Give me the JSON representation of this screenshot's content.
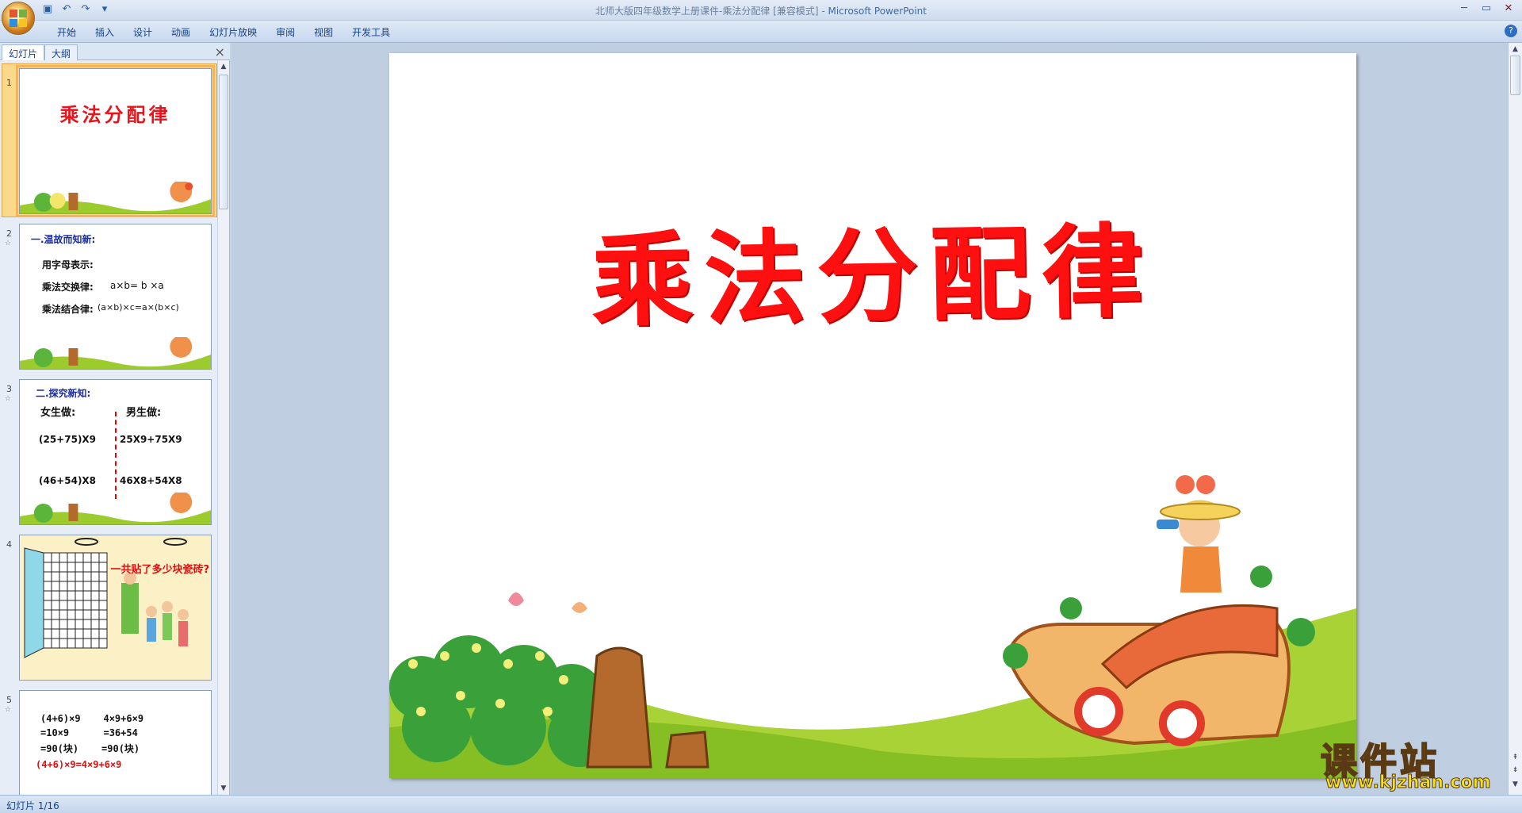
{
  "window": {
    "title": "北师大版四年级数学上册课件-乘法分配律 [兼容模式]",
    "app_name": "Microsoft PowerPoint"
  },
  "quick_access": {
    "save": "save-icon",
    "undo": "undo-icon",
    "redo": "redo-icon",
    "customize": "dropdown-icon"
  },
  "ribbon": {
    "tabs": [
      "开始",
      "插入",
      "设计",
      "动画",
      "幻灯片放映",
      "审阅",
      "视图",
      "开发工具"
    ]
  },
  "left_pane": {
    "tabs": [
      "幻灯片",
      "大纲"
    ],
    "close": "×",
    "thumbnails": [
      {
        "number": "1",
        "title": "乘法分配律"
      },
      {
        "number": "2",
        "heading": "一.温故而知新:",
        "line1": "用字母表示:",
        "line2": "乘法交换律:",
        "line2_val": "a×b= b ×a",
        "line3": "乘法结合律:",
        "line3_val": "(a×b)×c=a×(b×c)"
      },
      {
        "number": "3",
        "heading": "二.探究新知:",
        "girls": "女生做:",
        "boys": "男生做:",
        "row1_left": "(25+75)X9",
        "row1_right": "25X9+75X9",
        "row2_left": "(46+54)X8",
        "row2_right": "46X8+54X8"
      },
      {
        "number": "4",
        "question": "一共贴了多少块瓷砖?"
      },
      {
        "number": "5",
        "r1": "(4+6)×9    4×9+6×9",
        "r2": "=10×9      =36+54",
        "r3": "=90(块)    =90(块)",
        "r4": "(4+6)×9=4×9+6×9"
      }
    ]
  },
  "slide": {
    "title": "乘法分配律"
  },
  "status": {
    "text": "幻灯片 1/16"
  },
  "watermark": {
    "big": "课件站",
    "url": "www.kjzhan.com"
  },
  "colors": {
    "title_red": "#ff1010",
    "ribbon_bg": "#c7d8ee",
    "selection": "#f4b459"
  }
}
